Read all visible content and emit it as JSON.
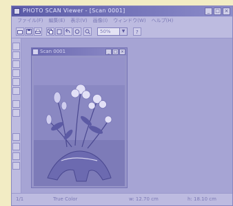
{
  "window": {
    "title": "PHOTO SCAN Viewer - [Scan 0001]",
    "controls": {
      "minimize": "_",
      "maximize": "□",
      "close": "×"
    }
  },
  "menubar": {
    "items": [
      {
        "label": "ファイル(F)"
      },
      {
        "label": "編集(E)"
      },
      {
        "label": "表示(V)"
      },
      {
        "label": "画像(I)"
      },
      {
        "label": "ウィンドウ(W)"
      },
      {
        "label": "ヘルプ(H)"
      }
    ]
  },
  "toolbar": {
    "zoom_value": "50%",
    "zoom_arrow": "▼"
  },
  "document": {
    "title": "Scan 0001",
    "controls": {
      "minimize": "_",
      "maximize": "□",
      "close": "×"
    }
  },
  "statusbar": {
    "page": "1/1",
    "mode": "True Color",
    "width": "w: 12.70 cm",
    "height": "h: 18.10 cm"
  },
  "colors": {
    "window_bg": "#a6a4d4",
    "titlebar": "#5a5aa6",
    "toolbar": "#bdbbe0",
    "page_bg": "#f2ecc4"
  }
}
